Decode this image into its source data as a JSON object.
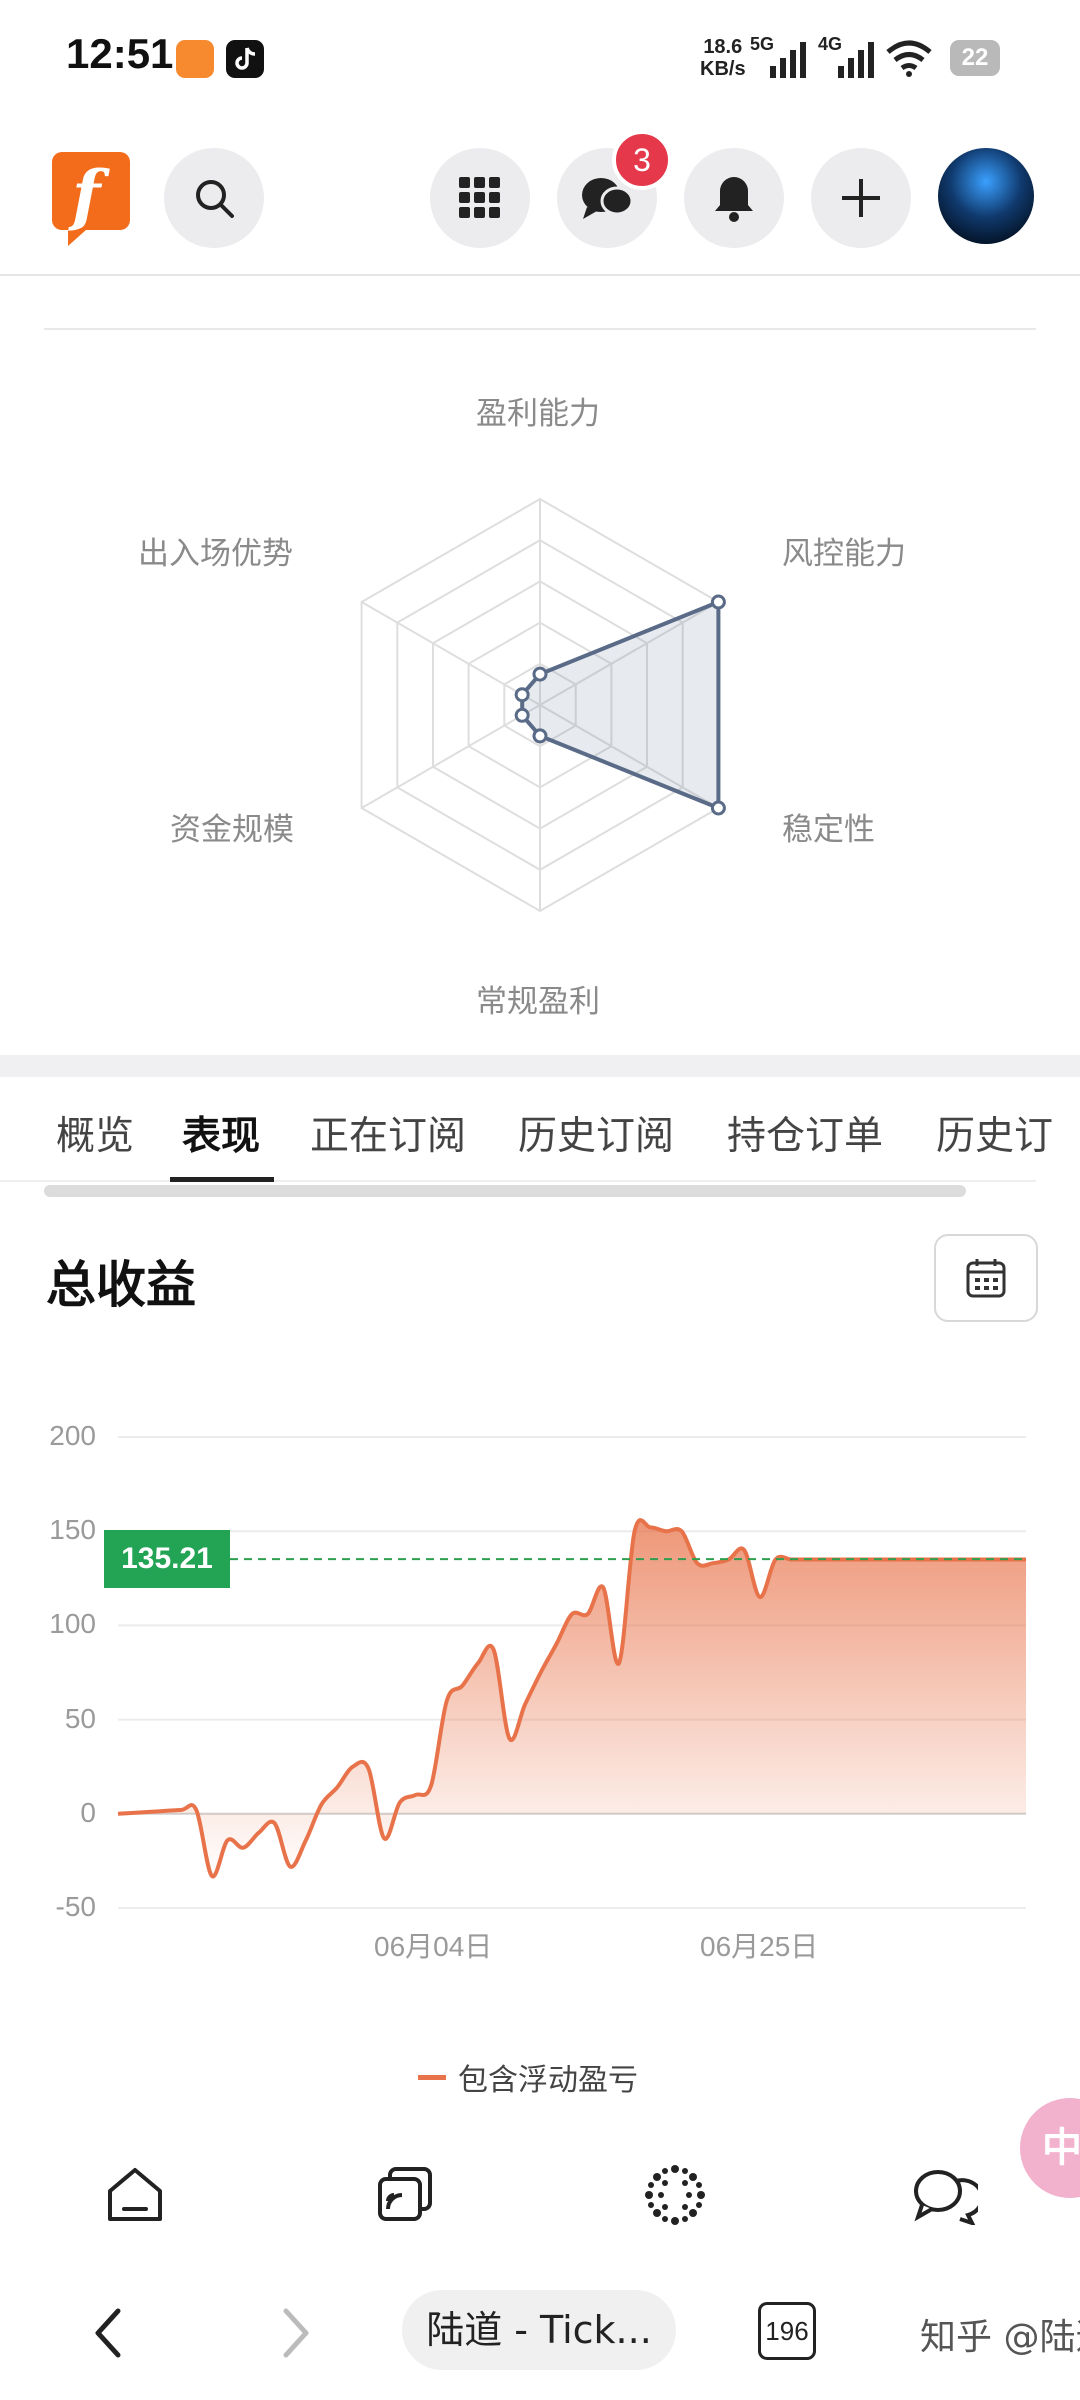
{
  "status_bar": {
    "time": "12:51",
    "net_speed_value": "18.6",
    "net_speed_unit": "KB/s",
    "signal_1": "5G",
    "signal_2": "4G",
    "battery": "22",
    "app_icons": [
      "shopping-bag-icon",
      "tiktok-icon"
    ]
  },
  "header": {
    "logo": "forexfactory-f-logo",
    "message_badge": "3",
    "icons": [
      "search-icon",
      "apps-grid-icon",
      "chat-bubbles-icon",
      "bell-icon",
      "plus-icon",
      "avatar"
    ]
  },
  "radar": {
    "labels": {
      "top": "盈利能力",
      "upper_right": "风控能力",
      "lower_right": "稳定性",
      "bottom": "常规盈利",
      "lower_left": "资金规模",
      "upper_left": "出入场优势"
    },
    "values": {
      "top": 0.15,
      "upper_right": 1.0,
      "lower_right": 1.0,
      "bottom": 0.15,
      "lower_left": 0.1,
      "upper_left": 0.1
    }
  },
  "tabs": [
    {
      "label": "概览",
      "active": false
    },
    {
      "label": "表现",
      "active": true
    },
    {
      "label": "正在订阅",
      "active": false
    },
    {
      "label": "历史订阅",
      "active": false
    },
    {
      "label": "持仓订单",
      "active": false
    },
    {
      "label": "历史订",
      "active": false
    }
  ],
  "section": {
    "title": "总收益"
  },
  "chart_data": {
    "type": "area",
    "y_ticks": [
      "200",
      "150",
      "100",
      "50",
      "0",
      "-50"
    ],
    "x_ticks": [
      "06月04日",
      "06月25日"
    ],
    "ylim": [
      -50,
      200
    ],
    "current_value_label": "135.21",
    "current_value": 135.21,
    "legend": "包含浮动盈亏",
    "line_color": "#e8734a",
    "reference_line_color": "#2e9e4f",
    "x": [
      0,
      2,
      4,
      5,
      6,
      7,
      8,
      9,
      10,
      11,
      12,
      13,
      14,
      15,
      16,
      17,
      18,
      19,
      20,
      21,
      22,
      23,
      24,
      25,
      26,
      27,
      28,
      29,
      30,
      31,
      32,
      33,
      34,
      35,
      36,
      37,
      38,
      39,
      40,
      41,
      42,
      43,
      44,
      45,
      46,
      47,
      48,
      49,
      50,
      51,
      52,
      53,
      54,
      55,
      56,
      57,
      58
    ],
    "values": [
      0,
      1,
      2,
      2,
      -33,
      -14,
      -18,
      -10,
      -5,
      -28,
      -14,
      5,
      14,
      25,
      24,
      -13,
      6,
      10,
      15,
      60,
      68,
      80,
      87,
      40,
      58,
      75,
      90,
      106,
      106,
      120,
      80,
      150,
      152,
      150,
      150,
      133,
      133,
      135,
      140,
      115,
      135,
      135,
      135,
      135,
      135,
      135,
      135,
      135,
      135,
      135,
      135,
      135,
      135,
      135,
      135,
      135,
      135
    ]
  },
  "bottom_nav": {
    "icons": [
      "home-icon",
      "copy-trade-icon",
      "community-icon",
      "chat-icon"
    ],
    "float_label": "中"
  },
  "browser_bar": {
    "url_label": "陆道 - Tick...",
    "tab_count": "196",
    "watermark": "知乎 @陆道"
  }
}
